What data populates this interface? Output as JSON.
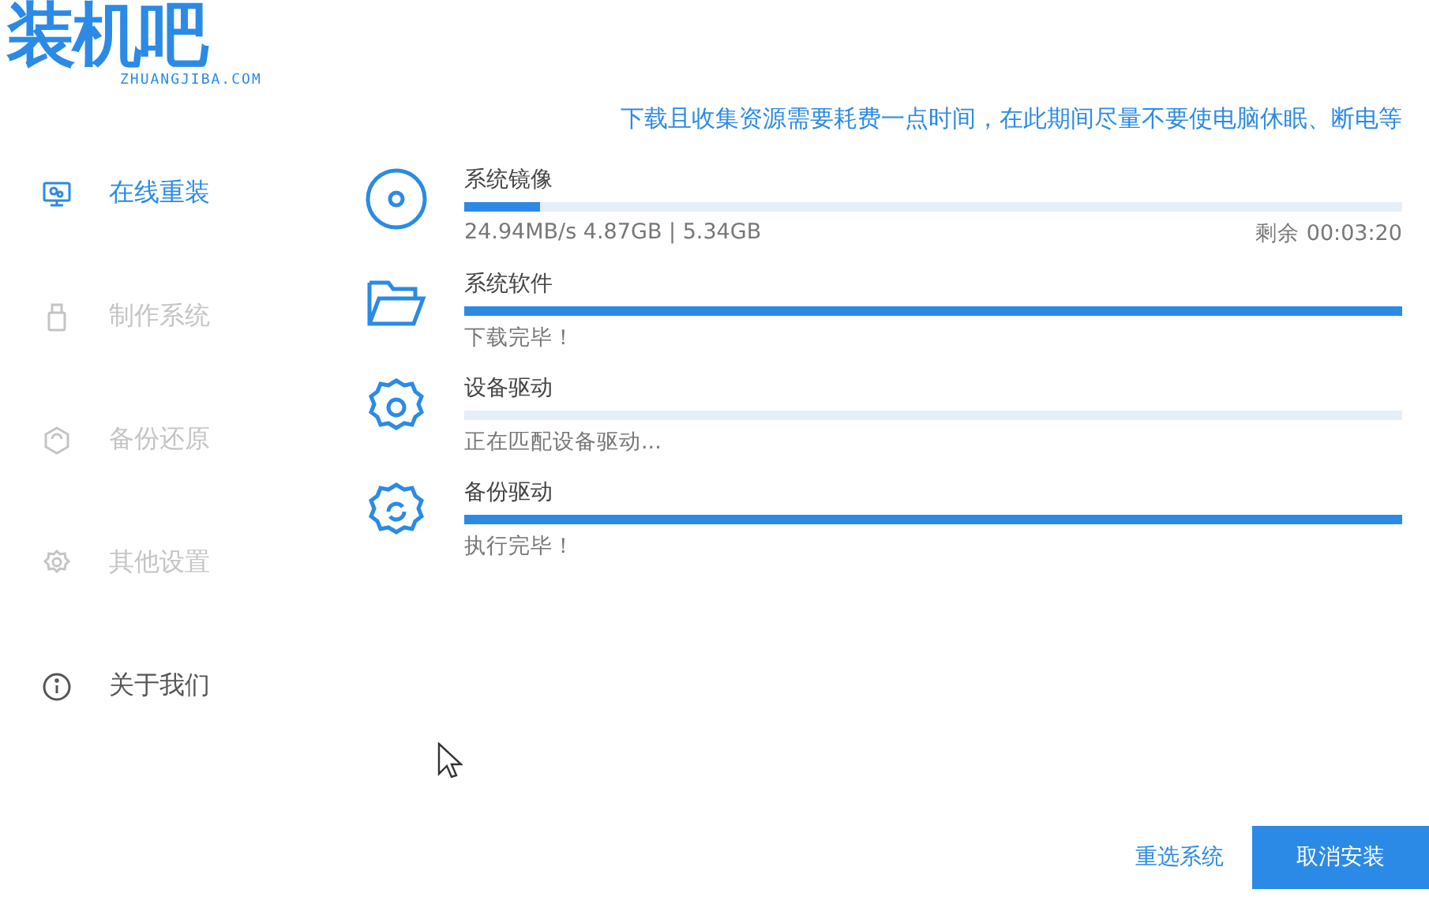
{
  "logo": {
    "title": "装机吧",
    "subtitle": "ZHUANGJIBA.COM"
  },
  "sidebar": {
    "items": [
      {
        "label": "在线重装",
        "selected": true,
        "disabled": false
      },
      {
        "label": "制作系统",
        "selected": false,
        "disabled": true
      },
      {
        "label": "备份还原",
        "selected": false,
        "disabled": true
      },
      {
        "label": "其他设置",
        "selected": false,
        "disabled": true
      },
      {
        "label": "关于我们",
        "selected": false,
        "disabled": false
      }
    ]
  },
  "notice": "下载且收集资源需要耗费一点时间，在此期间尽量不要使电脑休眠、断电等",
  "tasks": [
    {
      "title": "系统镜像",
      "level": 0.08,
      "status": "24.94MB/s 4.87GB | 5.34GB",
      "remaining": "剩余 00:03:20"
    },
    {
      "title": "系统软件",
      "level": 1,
      "status": "下载完毕！"
    },
    {
      "title": "设备驱动",
      "level": 0,
      "status": "正在匹配设备驱动..."
    },
    {
      "title": "备份驱动",
      "level": 1,
      "status": "执行完毕！"
    }
  ],
  "buttons": {
    "secondary": "重选系统",
    "primary": "取消安装"
  }
}
